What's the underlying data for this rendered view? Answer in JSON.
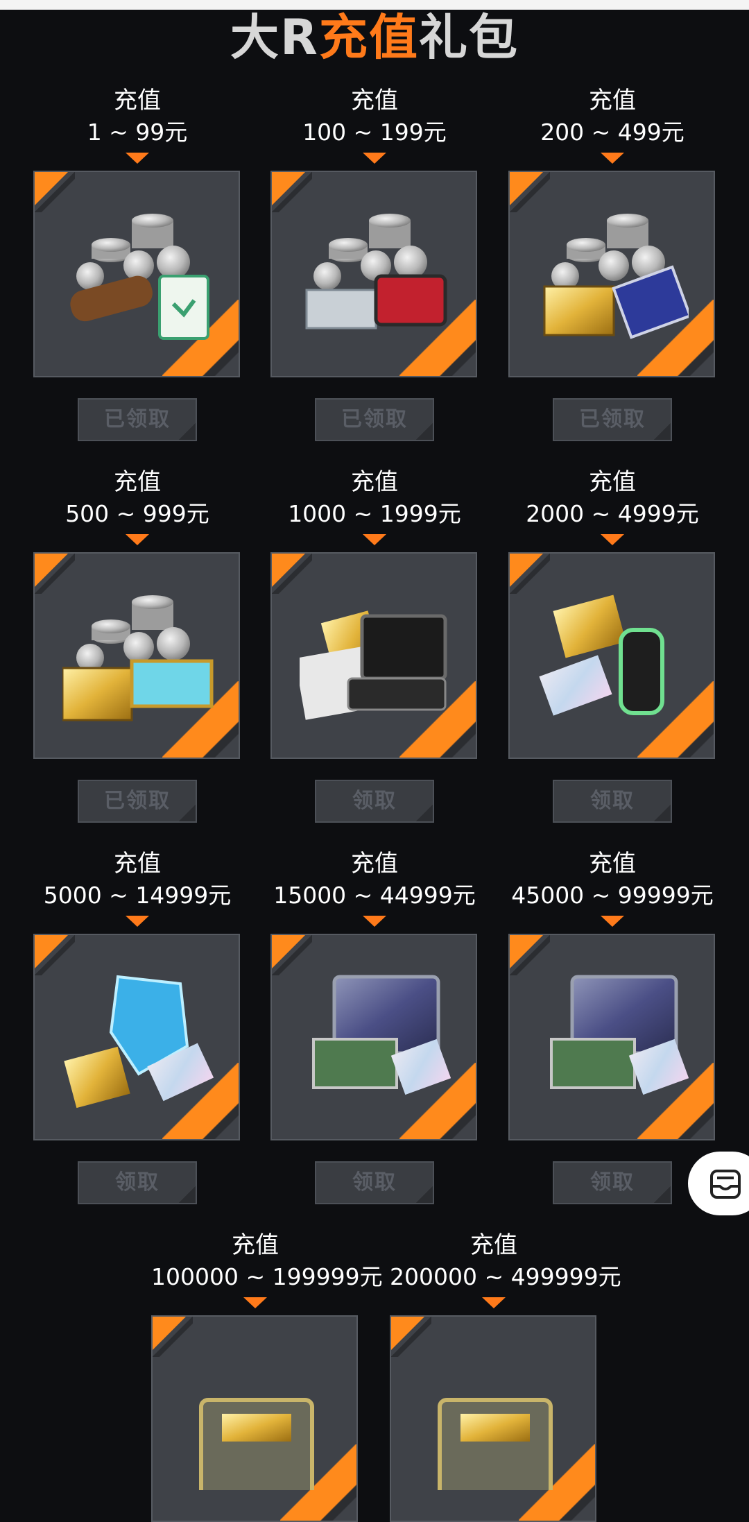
{
  "banner": {
    "title_part1": "大R",
    "title_part2": "充值",
    "title_part3": "礼包"
  },
  "tier_prefix": "充值",
  "tiers": [
    {
      "range": "1 ~ 99元",
      "button": "已领取",
      "art": "silver-coins-wood-medkit"
    },
    {
      "range": "100 ~ 199元",
      "button": "已领取",
      "art": "silver-coins-metal-cases"
    },
    {
      "range": "200 ~ 499元",
      "button": "已领取",
      "art": "silver-coins-gold-crate-card"
    },
    {
      "range": "500 ~ 999元",
      "button": "已领取",
      "art": "silver-coins-gold-cyan-crates"
    },
    {
      "range": "1000 ~ 1999元",
      "button": "领取",
      "art": "blueprints-tablet-gold-ticket"
    },
    {
      "range": "2000 ~ 4999元",
      "button": "领取",
      "art": "gold-ticket-card-canister"
    },
    {
      "range": "5000 ~ 14999元",
      "button": "领取",
      "art": "blue-crystal-gold-ticket-card"
    },
    {
      "range": "15000 ~ 44999元",
      "button": "领取",
      "art": "tech-crates-card"
    },
    {
      "range": "45000 ~ 99999元",
      "button": "领取",
      "art": "tech-crates-card"
    },
    {
      "range": "100000 ~ 199999元",
      "button": "",
      "art": "gold-armored-crate"
    },
    {
      "range": "200000 ~ 499999元",
      "button": "",
      "art": "gold-armored-crate"
    }
  ],
  "floating_button": {
    "icon": "message-tray-icon"
  },
  "colors": {
    "accent": "#ff7a1a",
    "background": "#0d0e11",
    "tile": "#3f4248"
  }
}
